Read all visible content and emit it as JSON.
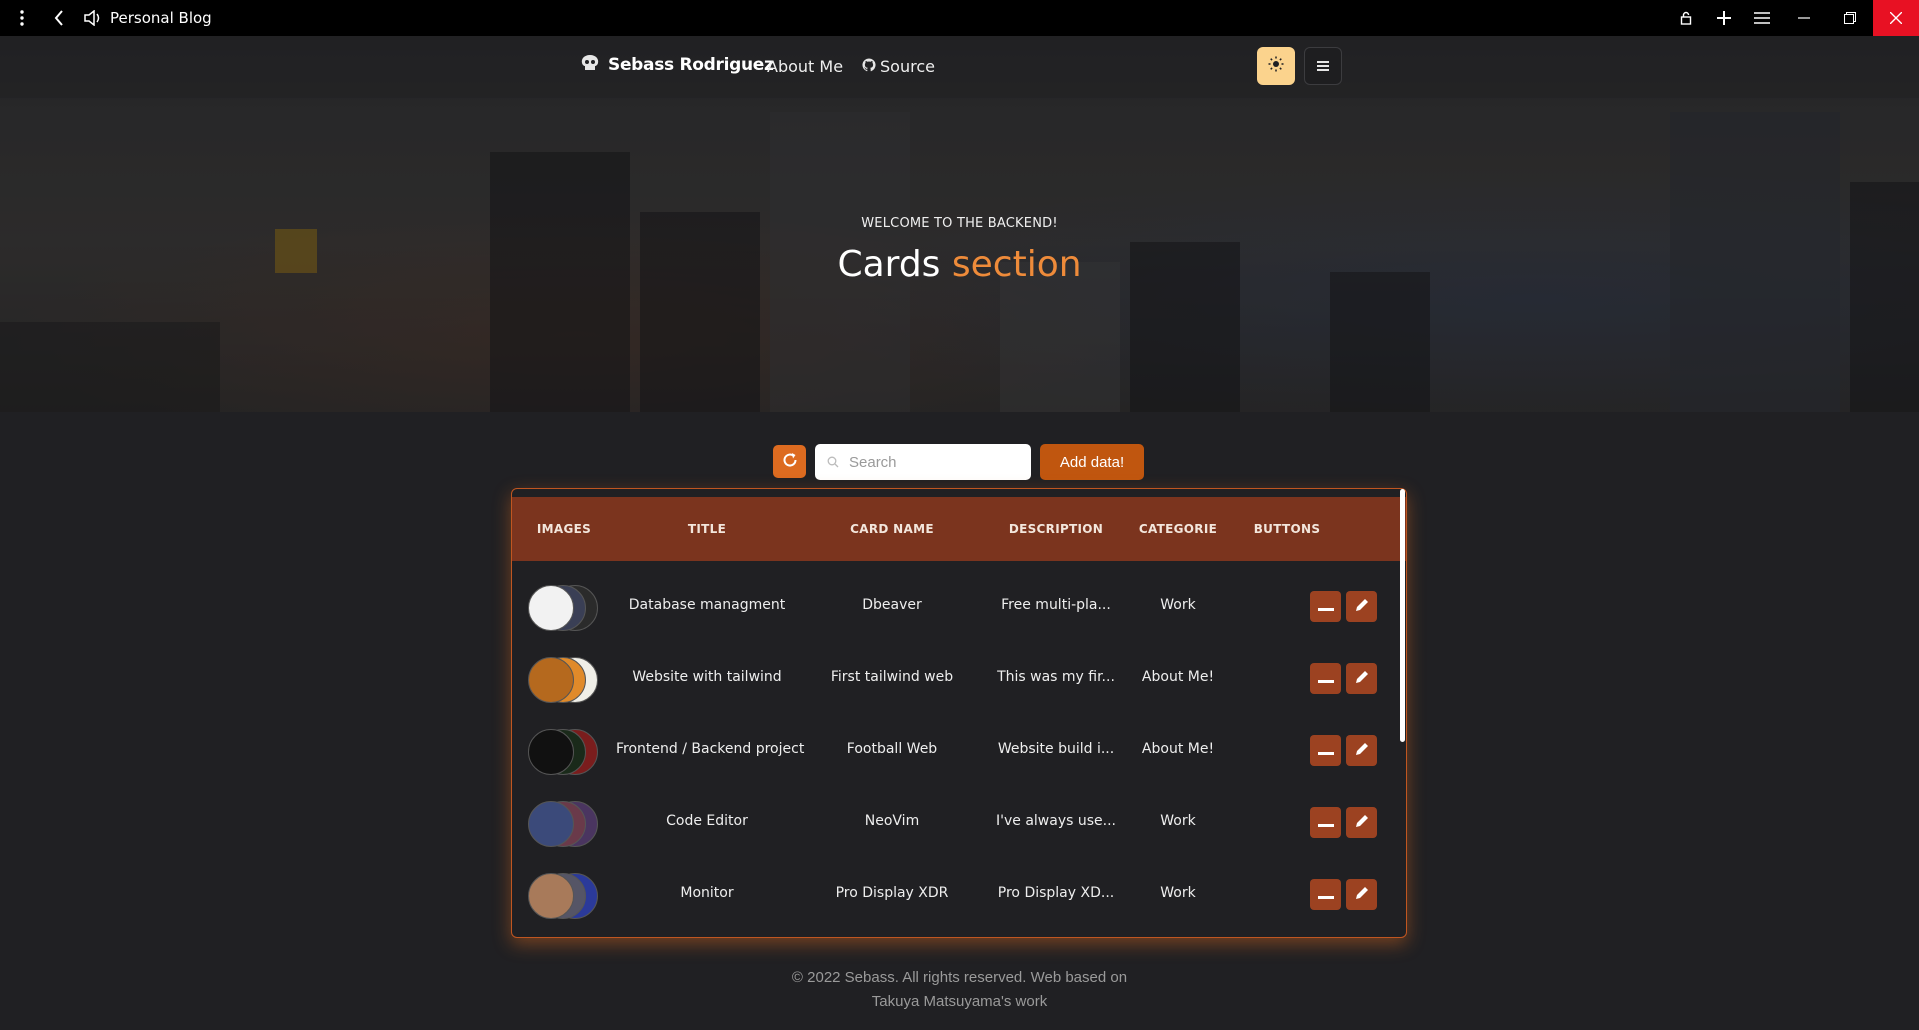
{
  "browser": {
    "title": "Personal Blog"
  },
  "nav": {
    "brand": "Sebass Rodriguez",
    "about": "About Me",
    "source": "Source"
  },
  "hero": {
    "subtitle": "WELCOME TO THE BACKEND!",
    "title_main": "Cards",
    "title_accent": "section"
  },
  "toolbar": {
    "search_placeholder": "Search",
    "add_label": "Add data!"
  },
  "table": {
    "columns": [
      "IMAGES",
      "TITLE",
      "CARD NAME",
      "DESCRIPTION",
      "CATEGORIE",
      "BUTTONS"
    ],
    "rows": [
      {
        "title": "Database managment",
        "card_name": "Dbeaver",
        "description": "Free multi-pla...",
        "category": "Work"
      },
      {
        "title": "Website with tailwind",
        "card_name": "First tailwind web",
        "description": "This was my fir...",
        "category": "About Me!"
      },
      {
        "title": "Frontend / Backend project",
        "card_name": "Football Web",
        "description": "Website build i...",
        "category": "About Me!"
      },
      {
        "title": "Code Editor",
        "card_name": "NeoVim",
        "description": "I've always use...",
        "category": "Work"
      },
      {
        "title": "Monitor",
        "card_name": "Pro Display XDR",
        "description": "Pro Display XD...",
        "category": "Work"
      }
    ]
  },
  "footer": {
    "line1": "© 2022 Sebass. All rights reserved. Web based on",
    "line2": "Takuya Matsuyama's work"
  },
  "colors": {
    "accent": "#dd6b20",
    "table_header": "#7b341e",
    "theme_button": "#fbd38d",
    "close_button": "#e81123"
  }
}
